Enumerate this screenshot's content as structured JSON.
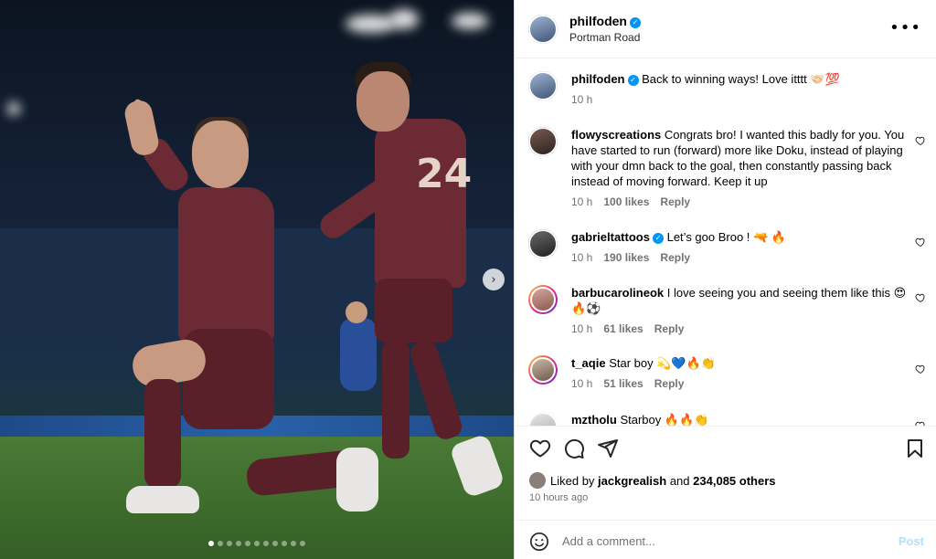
{
  "post": {
    "author": "philfoden",
    "location": "Portman Road",
    "caption_text": "Back to winning ways! Love itttt 🤝🏻💯",
    "caption_time": "10 h",
    "images_count": 11,
    "active_image": 1
  },
  "comments": [
    {
      "user": "flowyscreations",
      "text": "Congrats bro! I wanted this badly for you. You have started to run (forward) more like Doku, instead of playing with your dmn back to the goal, then constantly passing back instead of moving forward. Keep it up",
      "time": "10 h",
      "likes": "100 likes",
      "reply": "Reply",
      "verified": false
    },
    {
      "user": "gabrieltattoos",
      "text": "Let’s goo Broo ! 🔫 🔥",
      "time": "10 h",
      "likes": "190 likes",
      "reply": "Reply",
      "verified": true
    },
    {
      "user": "barbucarolineok",
      "text": "I love seeing you and seeing them like this 😍🔥⚽",
      "time": "10 h",
      "likes": "61 likes",
      "reply": "Reply",
      "verified": false
    },
    {
      "user": "t_aqie",
      "text": "Star boy 💫💙🔥👏",
      "time": "10 h",
      "likes": "51 likes",
      "reply": "Reply",
      "verified": false
    },
    {
      "user": "mztholu",
      "text": "Starboy 🔥🔥👏",
      "verified": false
    }
  ],
  "likes": {
    "prefix": "Liked by",
    "user": "jackgrealish",
    "joiner": "and",
    "count": "234,085 others"
  },
  "time_ago": "10 hours ago",
  "composer": {
    "placeholder": "Add a comment...",
    "post_label": "Post"
  },
  "colors": {
    "verified": "#0095f6",
    "post_disabled": "#b2dffc",
    "secondary_text": "#737373"
  }
}
